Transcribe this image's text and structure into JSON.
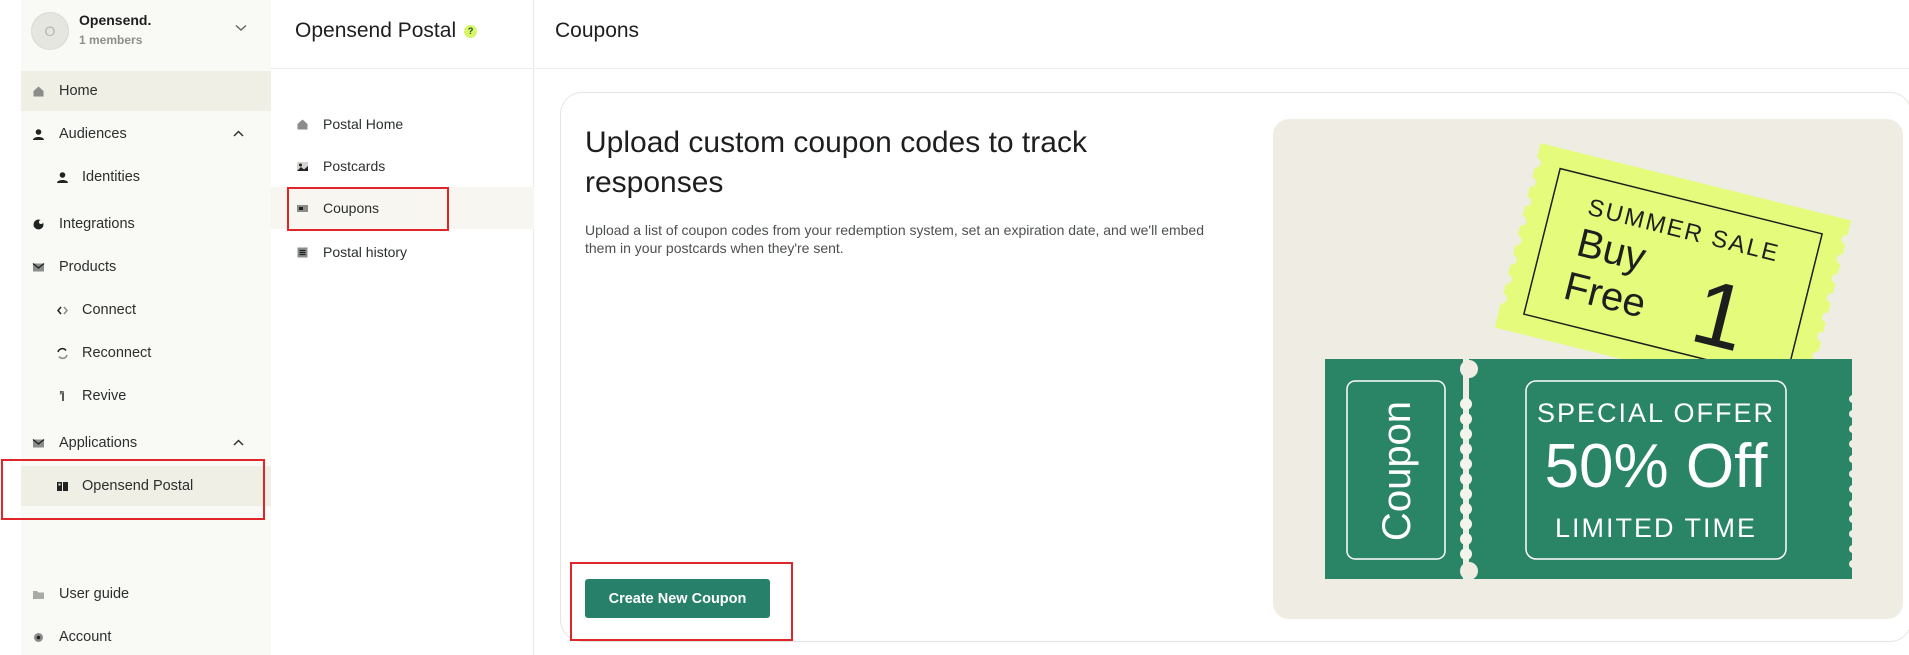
{
  "sidebar": {
    "org": {
      "avatar_initial": "O",
      "name": "Opensend.",
      "members": "1 members"
    },
    "items": [
      {
        "label": "Home",
        "icon": "home-icon"
      },
      {
        "label": "Audiences",
        "icon": "user-icon"
      },
      {
        "label": "Identities",
        "icon": "user-icon"
      },
      {
        "label": "Integrations",
        "icon": "integrations-icon"
      },
      {
        "label": "Products",
        "icon": "mail-icon"
      },
      {
        "label": "Connect",
        "icon": "connect-icon"
      },
      {
        "label": "Reconnect",
        "icon": "reconnect-icon"
      },
      {
        "label": "Revive",
        "icon": "revive-icon"
      },
      {
        "label": "Applications",
        "icon": "mail-icon"
      },
      {
        "label": "Opensend Postal",
        "icon": "postal-app-icon"
      },
      {
        "label": "User guide",
        "icon": "folder-icon"
      },
      {
        "label": "Account",
        "icon": "gear-icon"
      }
    ]
  },
  "postal_nav": {
    "title": "Opensend Postal",
    "badge": "?",
    "items": [
      {
        "label": "Postal Home",
        "icon": "home-icon"
      },
      {
        "label": "Postcards",
        "icon": "postcard-icon"
      },
      {
        "label": "Coupons",
        "icon": "coupon-icon"
      },
      {
        "label": "Postal history",
        "icon": "history-icon"
      }
    ]
  },
  "main": {
    "title": "Coupons",
    "heading": "Upload custom coupon codes to track responses",
    "description": "Upload a list of coupon codes from your redemption system, set an expiration date, and we'll embed them in your postcards when they're sent.",
    "create_button": "Create New Coupon"
  },
  "illustration": {
    "ticket1_line1": "SUMMER SALE",
    "ticket1_buy": "Buy",
    "ticket1_free": "Free",
    "ticket1_number": "1",
    "ticket2_stub": "Coupon",
    "ticket2_line1": "SPECIAL OFFER",
    "ticket2_big": "50% Off",
    "ticket2_line3": "LIMITED TIME"
  },
  "colors": {
    "brand_green": "#27806a",
    "ticket_green": "#2a8466",
    "ticket_yellow": "#e4fb7c",
    "highlight_red": "#e0262b",
    "sidebar_bg": "#f9f9f5"
  }
}
